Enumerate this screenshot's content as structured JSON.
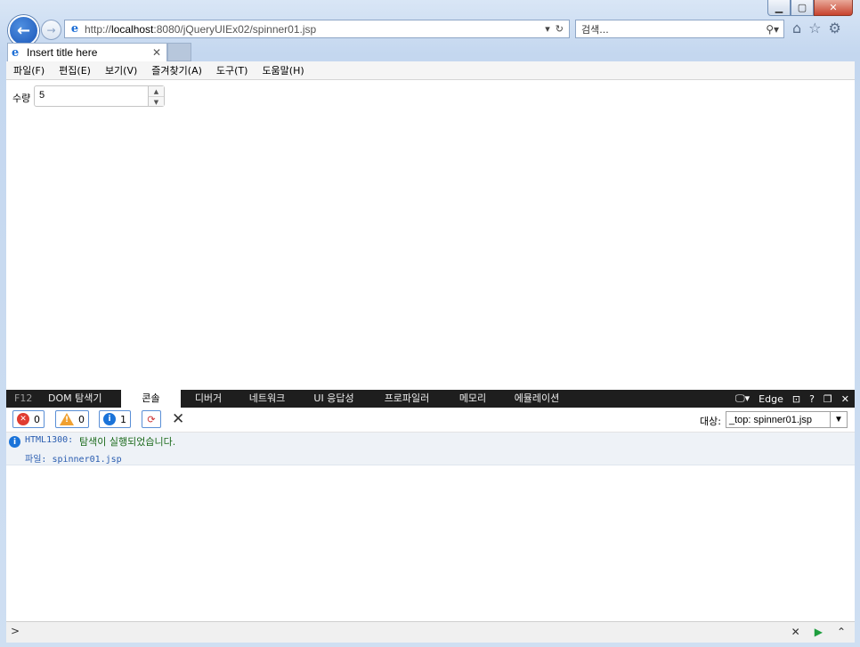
{
  "browser": {
    "url_prefix": "http://",
    "url_host": "localhost",
    "url_rest": ":8080/jQueryUIEx02/spinner01.jsp",
    "search_placeholder": "검색...",
    "tab_title": "Insert title here"
  },
  "menu": [
    "파일(F)",
    "편집(E)",
    "보기(V)",
    "즐겨찾기(A)",
    "도구(T)",
    "도움말(H)"
  ],
  "page": {
    "quantity_label": "수량",
    "quantity_value": "5"
  },
  "devtools": {
    "f12": "F12",
    "tabs": [
      "DOM 탐색기",
      "콘솔",
      "디버거",
      "네트워크",
      "UI 응답성",
      "프로파일러",
      "메모리",
      "에뮬레이션"
    ],
    "active_tab": "콘솔",
    "mode": "Edge",
    "help": "?",
    "counts": {
      "errors": "0",
      "warnings": "0",
      "info": "1"
    },
    "target_label": "대상:",
    "target_value": "_top: spinner01.jsp",
    "message": {
      "code": "HTML1300:",
      "text": "탐색이 실행되었습니다.",
      "file": "파일: spinner01.jsp"
    },
    "prompt": ">"
  },
  "colors": {
    "accent": "#1a73d9",
    "error": "#e03c31",
    "warning": "#f0a030",
    "devtools_bar": "#1e1e1e"
  }
}
